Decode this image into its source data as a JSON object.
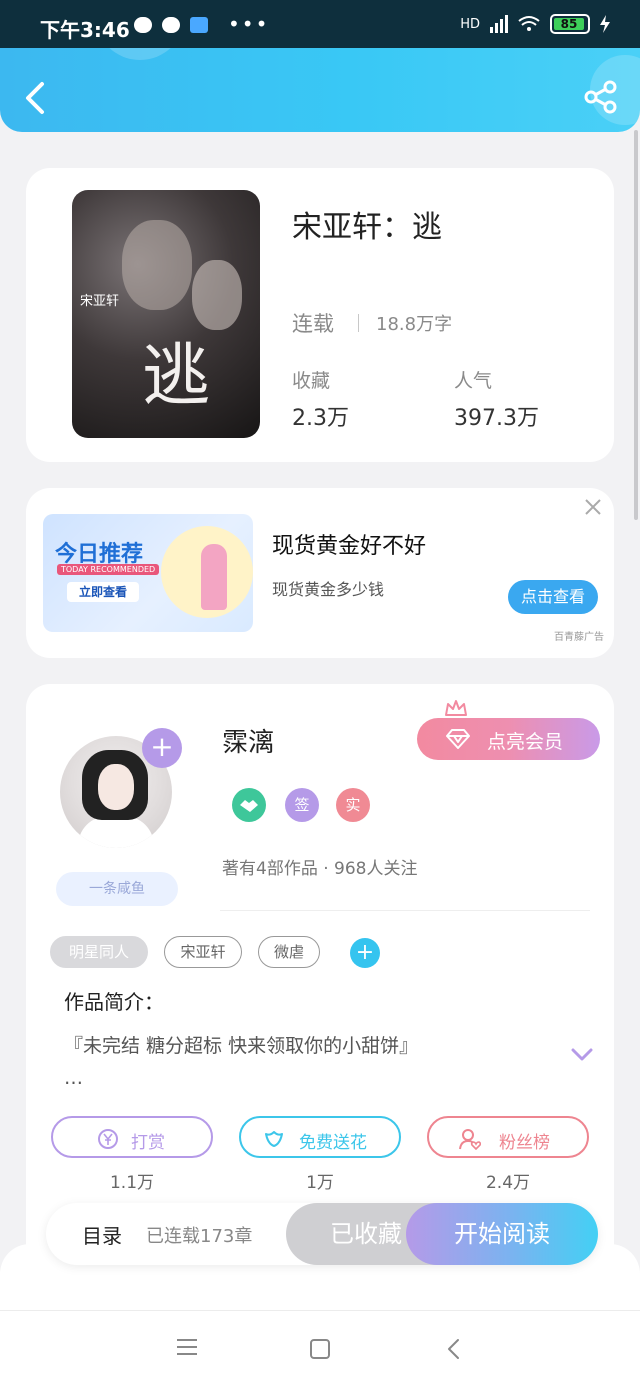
{
  "status_bar": {
    "time": "下午3:46",
    "more": "•••",
    "network": "HD",
    "battery": "85"
  },
  "book": {
    "title": "宋亚轩：逃",
    "cover_title": "逃",
    "cover_name": "宋亚轩",
    "status": "连载",
    "words": "18.8万字",
    "favorites_label": "收藏",
    "favorites_value": "2.3万",
    "popularity_label": "人气",
    "popularity_value": "397.3万"
  },
  "ad": {
    "banner_title": "今日推荐",
    "banner_sub": "TODAY RECOMMENDED",
    "banner_cta": "立即查看",
    "headline": "现货黄金好不好",
    "description": "现货黄金多少钱",
    "button": "点击查看",
    "source": "百青藤广告"
  },
  "author": {
    "name": "霂漓",
    "tag": "一条咸鱼",
    "follow_symbol": "+",
    "vip_button": "点亮会员",
    "badges": [
      "签",
      "实"
    ],
    "meta": "著有4部作品 · 968人关注",
    "chips": [
      "明星同人",
      "宋亚轩",
      "微虐"
    ],
    "chip_add": "+",
    "intro_label": "作品简介：",
    "intro_text": "『未完结 糖分超标 快来领取你的小甜饼』",
    "intro_ellipsis": "…",
    "actions": [
      {
        "label": "打赏",
        "count": "1.1万",
        "icon": "yen-icon",
        "color": "#b59ae8"
      },
      {
        "label": "免费送花",
        "count": "1万",
        "icon": "flower-icon",
        "color": "#3cc6ea"
      },
      {
        "label": "粉丝榜",
        "count": "2.4万",
        "icon": "fans-icon",
        "color": "#ee8590"
      }
    ]
  },
  "bottom": {
    "toc": "目录",
    "chapters": "已连载173章",
    "favorited": "已收藏",
    "start": "开始阅读"
  },
  "colors": {
    "accent": "#3cb8f0",
    "purple": "#b59ae8",
    "pink": "#f28aa0"
  }
}
